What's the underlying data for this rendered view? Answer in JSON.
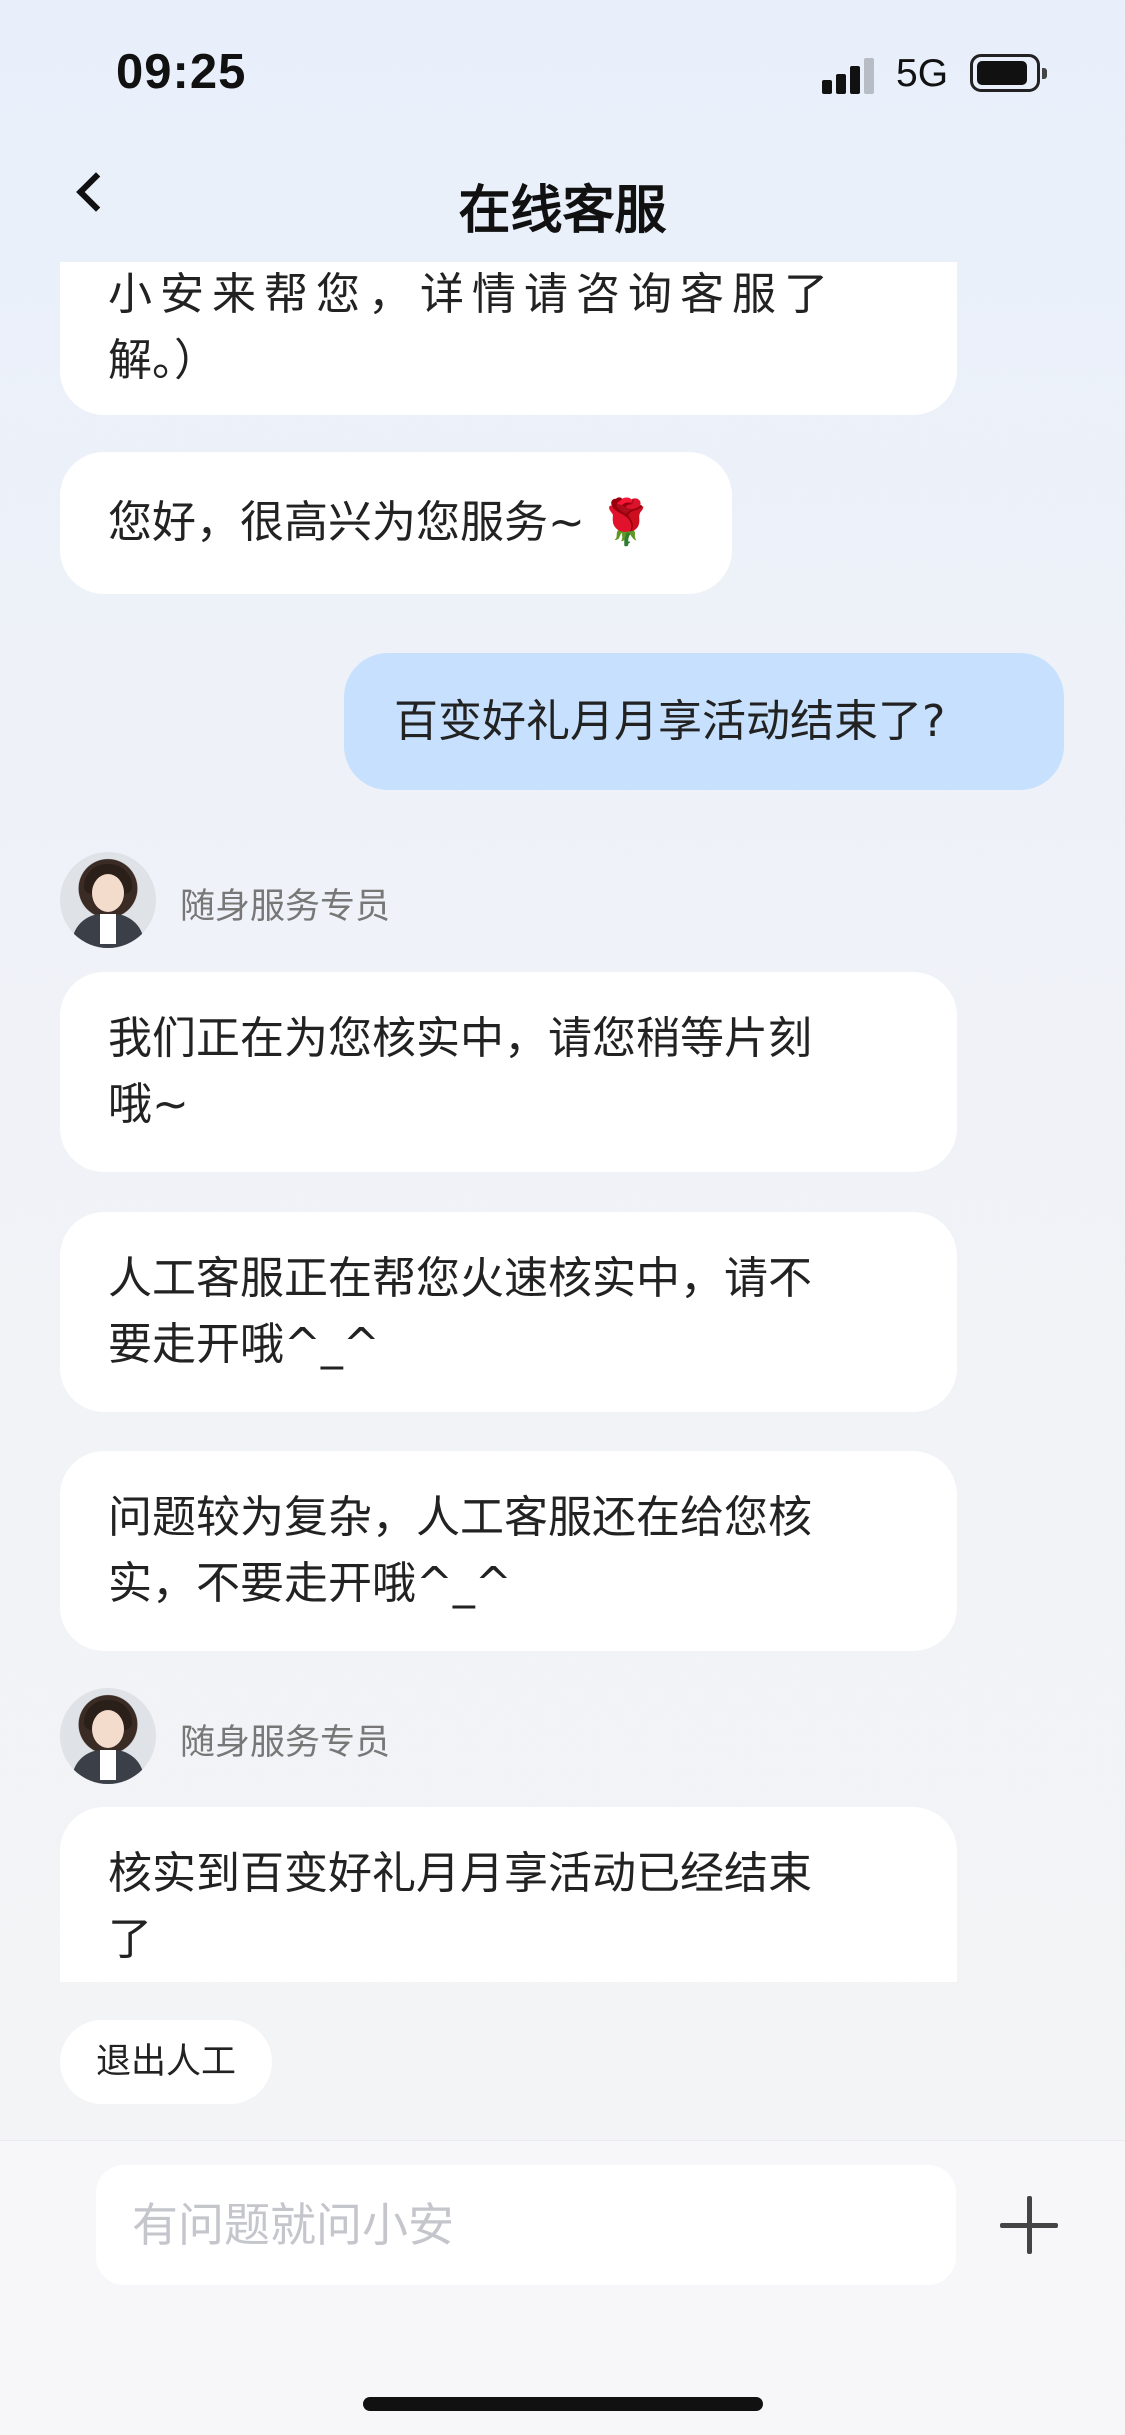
{
  "status_bar": {
    "time": "09:25",
    "network": "5G"
  },
  "header": {
    "title": "在线客服"
  },
  "messages": {
    "m0_line1": "小安来帮您，详情请咨询客服了",
    "m0_line2": "解。）",
    "m1": "您好，很高兴为您服务~",
    "user_msg": "百变好礼月月享活动结束了?",
    "agent_name": "随身服务专员",
    "m2_line1": "我们正在为您核实中，请您稍等片刻",
    "m2_line2": "哦~",
    "m3_line1": "人工客服正在帮您火速核实中，请不",
    "m3_line2": "要走开哦^_^",
    "m4_line1": "问题较为复杂，人工客服还在给您核",
    "m4_line2": "实，不要走开哦^_^",
    "m5_line1": "核实到百变好礼月月享活动已经结束",
    "m5_line2": "了"
  },
  "exit_button": "退出人工",
  "input": {
    "placeholder": "有问题就问小安"
  },
  "icons": {
    "back": "chevron-left-icon",
    "plus": "plus-icon",
    "rose": "rose-emoji-icon"
  }
}
